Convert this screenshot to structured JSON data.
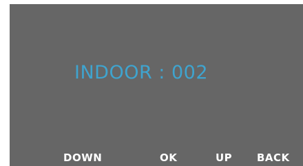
{
  "display": {
    "readout_label": "INDOOR",
    "readout_separator": " : ",
    "readout_value": "002",
    "text_color": "#3fa4cf",
    "background_color": "#666666"
  },
  "soft_keys": {
    "down": "DOWN",
    "ok": "OK",
    "up": "UP",
    "back": "BACK"
  }
}
